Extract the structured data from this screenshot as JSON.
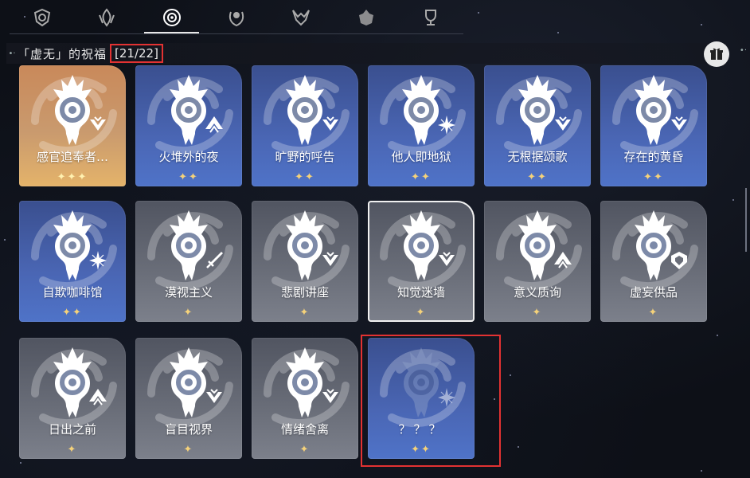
{
  "tabs": [
    {
      "icon": "shield-emblem-icon",
      "active": false
    },
    {
      "icon": "flame-emblem-icon",
      "active": false
    },
    {
      "icon": "nihility-emblem-icon",
      "active": true
    },
    {
      "icon": "laurel-emblem-icon",
      "active": false
    },
    {
      "icon": "horned-emblem-icon",
      "active": false
    },
    {
      "icon": "mask-emblem-icon",
      "active": false
    },
    {
      "icon": "trophy-emblem-icon",
      "active": false
    }
  ],
  "header": {
    "dots": "•·",
    "title": "「虚无」的祝福",
    "count": "[21/22]"
  },
  "gift_icon": "gift-icon",
  "colors": {
    "gold": "#c9895a",
    "blue": "#4a66b4",
    "grey": "#6a6e79",
    "highlight": "#e23232",
    "star": "#f5d27a"
  },
  "blessings": [
    {
      "name": "感官追奉者…",
      "stars": "✦✦✦",
      "style": "gold",
      "path_icon": "chevron-path-icon"
    },
    {
      "name": "火堆外的夜",
      "stars": "✦✦",
      "style": "blue",
      "path_icon": "arrow-up-path-icon"
    },
    {
      "name": "旷野的呼告",
      "stars": "✦✦",
      "style": "blue",
      "path_icon": "chevron-path-icon"
    },
    {
      "name": "他人即地狱",
      "stars": "✦✦",
      "style": "blue",
      "path_icon": "star-burst-path-icon"
    },
    {
      "name": "无根据颂歌",
      "stars": "✦✦",
      "style": "blue",
      "path_icon": "chevron-path-icon"
    },
    {
      "name": "存在的黄昏",
      "stars": "✦✦",
      "style": "blue",
      "path_icon": "chevron-path-icon"
    },
    {
      "name": "自欺咖啡馆",
      "stars": "✦✦",
      "style": "blue",
      "path_icon": "star-burst-path-icon"
    },
    {
      "name": "漠视主义",
      "stars": "✦",
      "style": "grey",
      "path_icon": "sword-path-icon"
    },
    {
      "name": "悲剧讲座",
      "stars": "✦",
      "style": "grey",
      "path_icon": "chevron-path-icon"
    },
    {
      "name": "知觉迷墙",
      "stars": "✦",
      "style": "grey",
      "path_icon": "chevron-path-icon",
      "selected": true
    },
    {
      "name": "意义质询",
      "stars": "✦",
      "style": "grey",
      "path_icon": "arrow-up-path-icon"
    },
    {
      "name": "虚妄供品",
      "stars": "✦",
      "style": "grey",
      "path_icon": "shield-path-icon"
    },
    {
      "name": "日出之前",
      "stars": "✦",
      "style": "grey",
      "path_icon": "arrow-up-path-icon"
    },
    {
      "name": "盲目视界",
      "stars": "✦",
      "style": "grey",
      "path_icon": "chevron-path-icon"
    },
    {
      "name": "情绪舍离",
      "stars": "✦",
      "style": "grey",
      "path_icon": "chevron-path-icon"
    },
    {
      "name": "？？？",
      "stars": "✦✦",
      "style": "blue",
      "path_icon": "star-burst-path-icon",
      "locked": true
    }
  ]
}
